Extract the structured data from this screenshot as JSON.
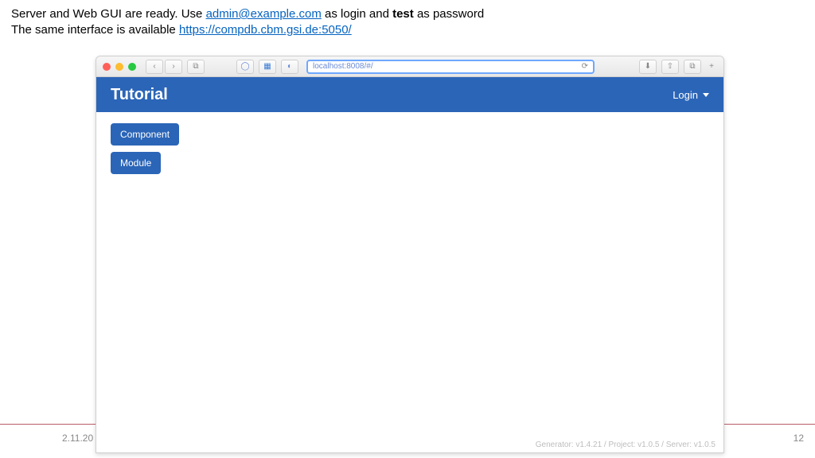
{
  "slide": {
    "line1_pre": "Server and Web GUI are ready. Use ",
    "email_link": "admin@example.com",
    "line1_mid": " as login and ",
    "password": "test",
    "line1_post": " as password",
    "line2_pre": "The same interface is available ",
    "url_link": "https://compdb.cbm.gsi.de:5050/",
    "date": "2.11.20",
    "page_num": "12"
  },
  "browser": {
    "url": "localhost:8008/#/",
    "back": "‹",
    "forward": "›",
    "sidebar": "⧉",
    "shield": "◯",
    "grid": "▦",
    "reader": "◐",
    "refresh": "⟳",
    "download": "⬇",
    "share": "⇧",
    "tabs": "⧉",
    "plus": "+"
  },
  "app": {
    "title": "Tutorial",
    "login_label": "Login",
    "buttons": {
      "component": "Component",
      "module": "Module"
    },
    "footer": "Generator: v1.4.21 / Project: v1.0.5 / Server: v1.0.5"
  }
}
